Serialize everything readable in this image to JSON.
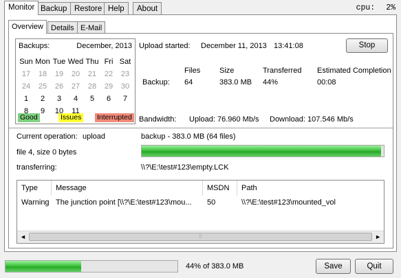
{
  "top_tabs": [
    "Monitor",
    "Backup",
    "Restore",
    "Help",
    "About"
  ],
  "cpu": {
    "label": "cpu:",
    "value": "2%"
  },
  "inner_tabs": [
    "Overview",
    "Details",
    "E-Mail"
  ],
  "calendar": {
    "label": "Backups:",
    "month": "December, 2013",
    "weekdays": [
      "Sun",
      "Mon",
      "Tue",
      "Wed",
      "Thu",
      "Fri",
      "Sat"
    ],
    "rows": [
      [
        "17",
        "18",
        "19",
        "20",
        "21",
        "22",
        "23"
      ],
      [
        "24",
        "25",
        "26",
        "27",
        "28",
        "29",
        "30"
      ],
      [
        "1",
        "2",
        "3",
        "4",
        "5",
        "6",
        "7"
      ],
      [
        "8",
        "9",
        "10",
        "11",
        "",
        "",
        ""
      ]
    ],
    "legend": {
      "good": "Good",
      "issues": "Issues",
      "interrupted": "Interrupted"
    },
    "colors": {
      "good": "#7fd27f",
      "issues": "#ffff33",
      "interrupted": "#f08a7a"
    }
  },
  "upload": {
    "label": "Upload started:",
    "date": "December 11, 2013",
    "time": "13:41:08",
    "stop_label": "Stop"
  },
  "stats": {
    "headers": {
      "files": "Files",
      "size": "Size",
      "transferred": "Transferred",
      "eta": "Estimated Completion"
    },
    "row_label": "Backup:",
    "files": "64",
    "size": "383.0 MB",
    "transferred": "44%",
    "eta": "00:08"
  },
  "bandwidth": {
    "label": "Bandwidth:",
    "upload": "Upload: 76.960 Mb/s",
    "download": "Download: 107.546 Mb/s"
  },
  "operation": {
    "label": "Current operation:",
    "value": "upload",
    "detail": "backup - 383.0 MB (64 files)",
    "progress": 0.99,
    "file_info": "file 4, size 0 bytes",
    "transferring_label": "transferring:",
    "transferring_path": "\\\\?\\E:\\test#123\\empty.LCK"
  },
  "messages": {
    "columns": [
      "Type",
      "Message",
      "MSDN",
      "Path"
    ],
    "rows": [
      {
        "type": "Warning",
        "message": "The junction point [\\\\?\\E:\\test#123\\mou...",
        "msdn": "50",
        "path": "\\\\?\\E:\\test#123\\mounted_vol"
      }
    ]
  },
  "footer": {
    "progress": 0.44,
    "progress_text": "44% of 383.0 MB",
    "save_label": "Save",
    "quit_label": "Quit"
  }
}
